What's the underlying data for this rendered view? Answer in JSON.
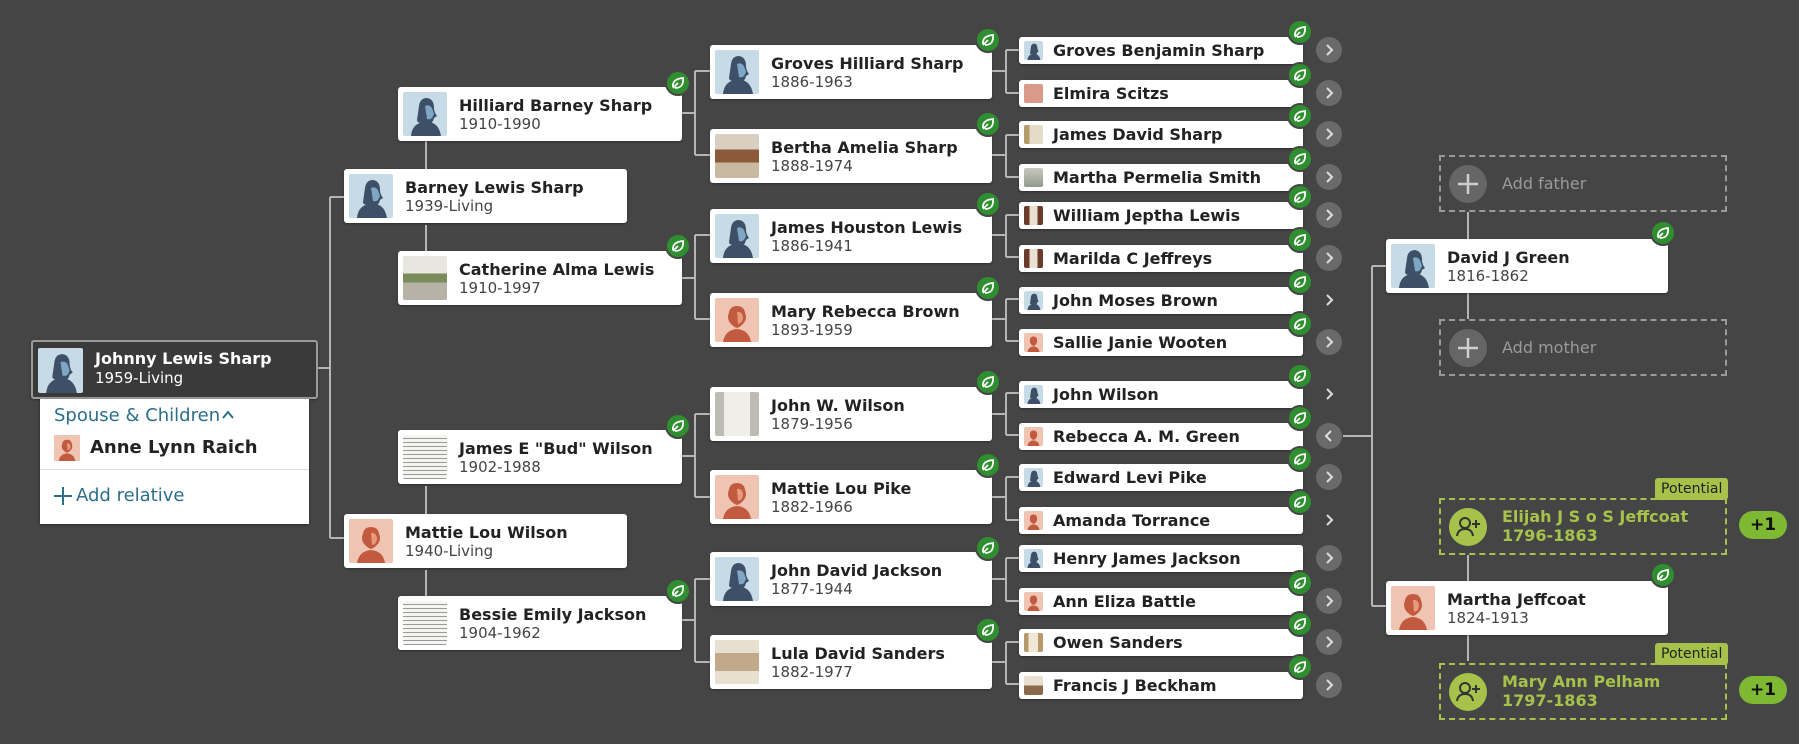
{
  "colors": {
    "background": "#454545",
    "connector": "#b5b5b5",
    "hint_leaf": "#2f8e2f",
    "potential": "#a6c24a",
    "plus_badge": "#7fb832",
    "link": "#2b6f8c",
    "male_avatar_bg": "#c7dbe6",
    "female_avatar_bg": "#f0c4b2"
  },
  "root": {
    "name": "Johnny Lewis Sharp",
    "dates": "1959-Living",
    "photo": "male-silhouette-icon"
  },
  "spouse_panel": {
    "header": "Spouse & Children",
    "spouse_name": "Anne Lynn Raich",
    "add_label": "Add relative"
  },
  "parents": {
    "father": {
      "name": "Barney Lewis Sharp",
      "dates": "1939-Living",
      "photo": "male-silhouette-icon"
    },
    "mother": {
      "name": "Mattie Lou Wilson",
      "dates": "1940-Living",
      "photo": "female-silhouette-icon"
    }
  },
  "grandparents": [
    {
      "name": "Hilliard Barney Sharp",
      "dates": "1910-1990",
      "photo": "male-silhouette-icon"
    },
    {
      "name": "Catherine Alma Lewis",
      "dates": "1910-1997",
      "photo": "photo-thumbnail"
    },
    {
      "name": "James E \"Bud\" Wilson",
      "dates": "1902-1988",
      "photo": "document-thumbnail"
    },
    {
      "name": "Bessie Emily Jackson",
      "dates": "1904-1962",
      "photo": "document-thumbnail"
    }
  ],
  "great_grandparents": [
    {
      "name": "Groves Hilliard Sharp",
      "dates": "1886-1963",
      "photo": "male-silhouette-icon"
    },
    {
      "name": "Bertha Amelia Sharp",
      "dates": "1888-1974",
      "photo": "photo-thumbnail"
    },
    {
      "name": "James Houston Lewis",
      "dates": "1886-1941",
      "photo": "male-silhouette-icon"
    },
    {
      "name": "Mary Rebecca Brown",
      "dates": "1893-1959",
      "photo": "female-silhouette-icon"
    },
    {
      "name": "John W. Wilson",
      "dates": "1879-1956",
      "photo": "photo-thumbnail"
    },
    {
      "name": "Mattie Lou Pike",
      "dates": "1882-1966",
      "photo": "female-silhouette-icon"
    },
    {
      "name": "John David Jackson",
      "dates": "1877-1944",
      "photo": "male-silhouette-icon"
    },
    {
      "name": "Lula David Sanders",
      "dates": "1882-1977",
      "photo": "photo-thumbnail"
    }
  ],
  "gen4": [
    {
      "name": "Groves Benjamin Sharp",
      "photo": "male-silhouette-icon"
    },
    {
      "name": "Elmira Scitzs",
      "photo": "photo-thumbnail"
    },
    {
      "name": "James David Sharp",
      "photo": "photo-thumbnail"
    },
    {
      "name": "Martha Permelia Smith",
      "photo": "photo-thumbnail"
    },
    {
      "name": "William Jeptha Lewis",
      "photo": "photo-thumbnail"
    },
    {
      "name": "Marilda C Jeffreys",
      "photo": "photo-thumbnail"
    },
    {
      "name": "John Moses Brown",
      "photo": "male-silhouette-icon"
    },
    {
      "name": "Sallie Janie Wooten",
      "photo": "female-silhouette-icon"
    },
    {
      "name": "John Wilson",
      "photo": "male-silhouette-icon"
    },
    {
      "name": "Rebecca A. M. Green",
      "photo": "female-silhouette-icon"
    },
    {
      "name": "Edward Levi Pike",
      "photo": "male-silhouette-icon"
    },
    {
      "name": "Amanda Torrance",
      "photo": "female-silhouette-icon"
    },
    {
      "name": "Henry James Jackson",
      "photo": "male-silhouette-icon"
    },
    {
      "name": "Ann Eliza Battle",
      "photo": "female-silhouette-icon"
    },
    {
      "name": "Owen Sanders",
      "photo": "photo-thumbnail"
    },
    {
      "name": "Francis J Beckham",
      "photo": "photo-thumbnail"
    }
  ],
  "expanded_branch": {
    "add_father": "Add father",
    "add_mother": "Add mother",
    "father": {
      "name": "David J Green",
      "dates": "1816-1862",
      "photo": "male-silhouette-icon"
    },
    "mother": {
      "name": "Martha Jeffcoat",
      "dates": "1824-1913",
      "photo": "female-silhouette-icon"
    },
    "potential_label": "Potential",
    "potential_father": {
      "name": "Elijah J S o S Jeffcoat",
      "dates": "1796-1863",
      "badge": "+1"
    },
    "potential_mother": {
      "name": "Mary Ann Pelham",
      "dates": "1797-1863",
      "badge": "+1"
    }
  }
}
